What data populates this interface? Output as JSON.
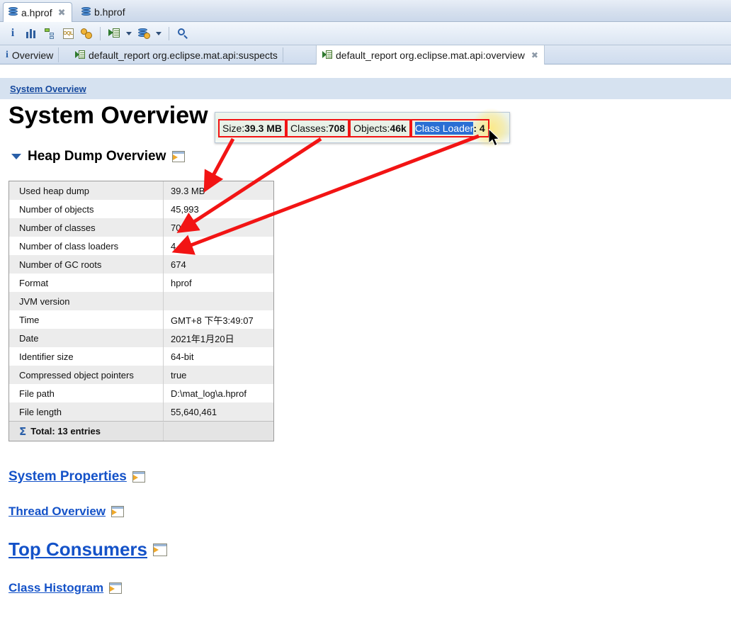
{
  "editor_tabs": [
    {
      "label": "a.hprof",
      "icon": "database-icon",
      "active": true,
      "closable": true
    },
    {
      "label": "b.hprof",
      "icon": "database-icon",
      "active": false,
      "closable": false
    }
  ],
  "toolbar": {
    "buttons": [
      {
        "name": "overview-info-button",
        "icon": "info-i-icon"
      },
      {
        "name": "histogram-button",
        "icon": "bar-chart-icon"
      },
      {
        "name": "dominator-tree-button",
        "icon": "tree-icon"
      },
      {
        "name": "oql-button",
        "icon": "oql-icon"
      },
      {
        "name": "calculate-retained-size-button",
        "icon": "gears-icon"
      },
      {
        "name": "run-report-button",
        "icon": "run-report-icon"
      },
      {
        "name": "query-browser-button",
        "icon": "database-gear-icon"
      },
      {
        "name": "find-button",
        "icon": "search-icon"
      }
    ]
  },
  "report_tabs": [
    {
      "label": "Overview",
      "icon": "info-i-icon",
      "active": false,
      "closable": false
    },
    {
      "label": "default_report  org.eclipse.mat.api:suspects",
      "icon": "report-icon",
      "active": false,
      "closable": false
    },
    {
      "label": "default_report  org.eclipse.mat.api:overview",
      "icon": "report-icon",
      "active": true,
      "closable": true
    }
  ],
  "breadcrumb": {
    "label": "System Overview"
  },
  "page": {
    "title": "System Overview",
    "section": {
      "label": "Heap Dump Overview",
      "expanded": true,
      "icon": "open-in-window-icon"
    }
  },
  "table": {
    "rows": [
      {
        "key": "Used heap dump",
        "value": "39.3 MB"
      },
      {
        "key": "Number of objects",
        "value": "45,993"
      },
      {
        "key": "Number of classes",
        "value": "708"
      },
      {
        "key": "Number of class loaders",
        "value": "4"
      },
      {
        "key": "Number of GC roots",
        "value": "674"
      },
      {
        "key": "Format",
        "value": "hprof"
      },
      {
        "key": "JVM version",
        "value": ""
      },
      {
        "key": "Time",
        "value": "GMT+8 下午3:49:07"
      },
      {
        "key": "Date",
        "value": "2021年1月20日"
      },
      {
        "key": "Identifier size",
        "value": "64-bit"
      },
      {
        "key": "Compressed object pointers",
        "value": "true"
      },
      {
        "key": "File path",
        "value": "D:\\mat_log\\a.hprof"
      },
      {
        "key": "File length",
        "value": "55,640,461"
      }
    ],
    "total_label": "Total: 13 entries",
    "total_icon": "sigma-icon"
  },
  "links": [
    {
      "label": "System Properties",
      "icon": "open-in-window-icon"
    },
    {
      "label": "Thread Overview",
      "icon": "open-in-window-icon"
    },
    {
      "label": "Top Consumers",
      "icon": "open-in-window-icon"
    },
    {
      "label": "Class Histogram",
      "icon": "open-in-window-icon"
    }
  ],
  "tooltip": {
    "items": [
      {
        "label": "Size: ",
        "value": "39.3 MB",
        "highlighted": false
      },
      {
        "label": "Classes: ",
        "value": "708",
        "highlighted": false
      },
      {
        "label": "Objects: ",
        "value": "46k",
        "highlighted": false
      },
      {
        "label": "Class Loader",
        "value": ": 4",
        "highlighted": true
      }
    ]
  },
  "annotation": {
    "arrow_color": "#f21414",
    "highlight_color": "#2a6fd4",
    "glow_color": "#ffe778"
  }
}
